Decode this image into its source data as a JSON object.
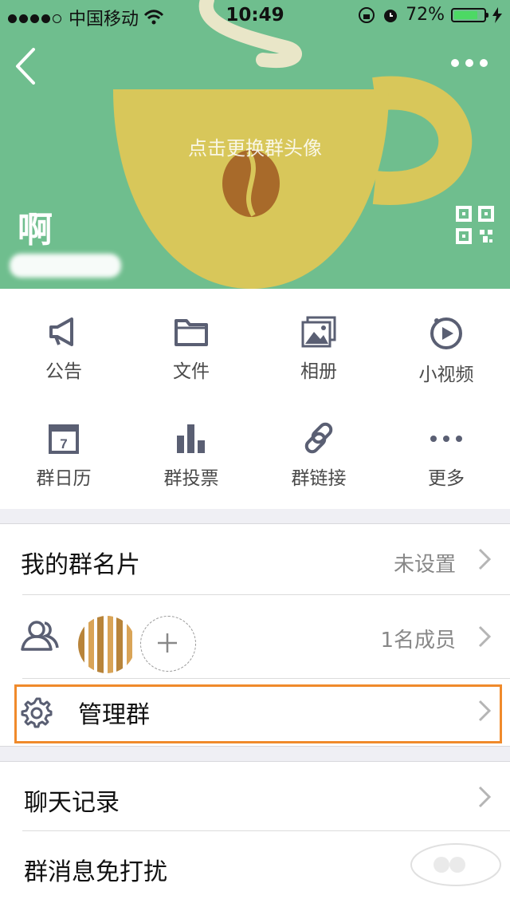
{
  "status_bar": {
    "carrier": "中国移动",
    "time": "10:49",
    "battery": "72%"
  },
  "header": {
    "group_name": "啊",
    "cover_hint": "点击更换群头像"
  },
  "functions": [
    {
      "label": "公告",
      "icon": "megaphone-icon"
    },
    {
      "label": "文件",
      "icon": "folder-icon"
    },
    {
      "label": "相册",
      "icon": "album-icon"
    },
    {
      "label": "小视频",
      "icon": "video-icon"
    },
    {
      "label": "群日历",
      "icon": "calendar-icon"
    },
    {
      "label": "群投票",
      "icon": "vote-chart-icon"
    },
    {
      "label": "群链接",
      "icon": "link-icon"
    },
    {
      "label": "更多",
      "icon": "more-dots-icon"
    }
  ],
  "settings": {
    "my_card": {
      "label": "我的群名片",
      "value": "未设置"
    },
    "members": {
      "value": "1名成员"
    },
    "manage": {
      "label": "管理群"
    },
    "chat_history": {
      "label": "聊天记录"
    },
    "mute": {
      "label": "群消息免打扰"
    }
  },
  "calendar_day": "7",
  "colors": {
    "cover": "#6fbe8e",
    "cup": "#d8c75a",
    "highlight": "#f08a2b",
    "icon": "#5a5f73"
  }
}
